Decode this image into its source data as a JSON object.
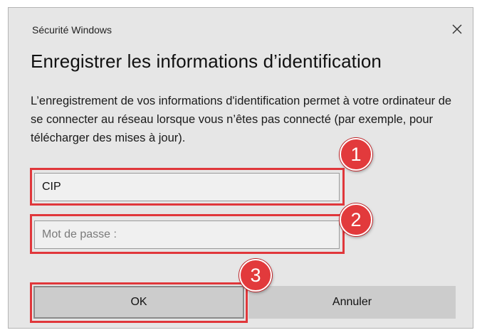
{
  "window": {
    "app_title": "Sécurité Windows",
    "heading": "Enregistrer les informations d’identification",
    "description": "L’enregistrement de vos informations d'identification permet à votre ordinateur de se connecter au réseau lorsque vous n’êtes pas connecté (par exemple, pour télécharger des mises à jour)."
  },
  "form": {
    "username_value": "CIP",
    "password_placeholder": "Mot de passe :"
  },
  "buttons": {
    "ok_label": "OK",
    "cancel_label": "Annuler"
  },
  "annotations": {
    "step1": "1",
    "step2": "2",
    "step3": "3",
    "highlight_color": "#e0373b",
    "badge_color": "#e23a3c"
  },
  "icons": {
    "close": "close-icon"
  }
}
